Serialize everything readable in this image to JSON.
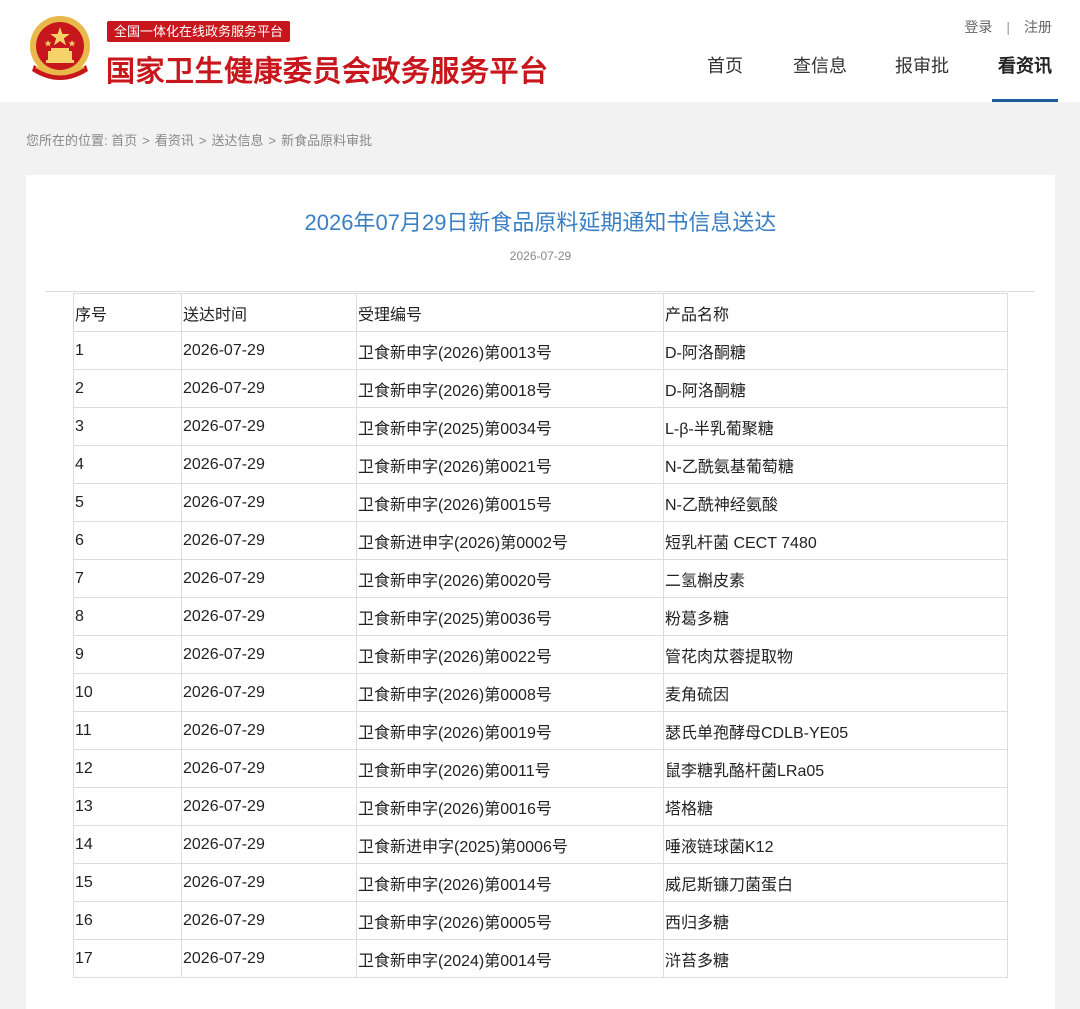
{
  "header": {
    "platform_tag": "全国一体化在线政务服务平台",
    "site_title": "国家卫生健康委员会政务服务平台",
    "login": "登录",
    "separator": "|",
    "register": "注册",
    "nav": [
      {
        "label": "首页"
      },
      {
        "label": "查信息"
      },
      {
        "label": "报审批"
      },
      {
        "label": "看资讯",
        "active": true
      }
    ]
  },
  "breadcrumb": {
    "prefix": "您所在的位置:",
    "items": [
      "首页",
      "看资讯",
      "送达信息",
      "新食品原料审批"
    ],
    "separator": ">"
  },
  "article": {
    "title": "2026年07月29日新食品原料延期通知书信息送达",
    "date": "2026-07-29"
  },
  "table": {
    "headers": [
      "序号",
      "送达时间",
      "受理编号",
      "产品名称"
    ],
    "rows": [
      [
        "1",
        "2026-07-29",
        "卫食新申字(2026)第0013号",
        "D-阿洛酮糖"
      ],
      [
        "2",
        "2026-07-29",
        "卫食新申字(2026)第0018号",
        "D-阿洛酮糖"
      ],
      [
        "3",
        "2026-07-29",
        "卫食新申字(2025)第0034号",
        "L-β-半乳葡聚糖"
      ],
      [
        "4",
        "2026-07-29",
        "卫食新申字(2026)第0021号",
        "N-乙酰氨基葡萄糖"
      ],
      [
        "5",
        "2026-07-29",
        "卫食新申字(2026)第0015号",
        "N-乙酰神经氨酸"
      ],
      [
        "6",
        "2026-07-29",
        "卫食新进申字(2026)第0002号",
        "短乳杆菌 CECT 7480"
      ],
      [
        "7",
        "2026-07-29",
        "卫食新申字(2026)第0020号",
        "二氢槲皮素"
      ],
      [
        "8",
        "2026-07-29",
        "卫食新申字(2025)第0036号",
        "粉葛多糖"
      ],
      [
        "9",
        "2026-07-29",
        "卫食新申字(2026)第0022号",
        "管花肉苁蓉提取物"
      ],
      [
        "10",
        "2026-07-29",
        "卫食新申字(2026)第0008号",
        "麦角硫因"
      ],
      [
        "11",
        "2026-07-29",
        "卫食新申字(2026)第0019号",
        "瑟氏单孢酵母CDLB-YE05"
      ],
      [
        "12",
        "2026-07-29",
        "卫食新申字(2026)第0011号",
        "鼠李糖乳酪杆菌LRa05"
      ],
      [
        "13",
        "2026-07-29",
        "卫食新申字(2026)第0016号",
        "塔格糖"
      ],
      [
        "14",
        "2026-07-29",
        "卫食新进申字(2025)第0006号",
        "唾液链球菌K12"
      ],
      [
        "15",
        "2026-07-29",
        "卫食新申字(2026)第0014号",
        "威尼斯镰刀菌蛋白"
      ],
      [
        "16",
        "2026-07-29",
        "卫食新申字(2026)第0005号",
        "西归多糖"
      ],
      [
        "17",
        "2026-07-29",
        "卫食新申字(2024)第0014号",
        "浒苔多糖"
      ]
    ]
  },
  "colors": {
    "brand_red": "#c8161d",
    "title_blue": "#3a7fc4",
    "nav_underline": "#1f5a99",
    "emblem_gold": "#e8b84a"
  },
  "icons": {
    "emblem": "national-emblem-icon"
  }
}
